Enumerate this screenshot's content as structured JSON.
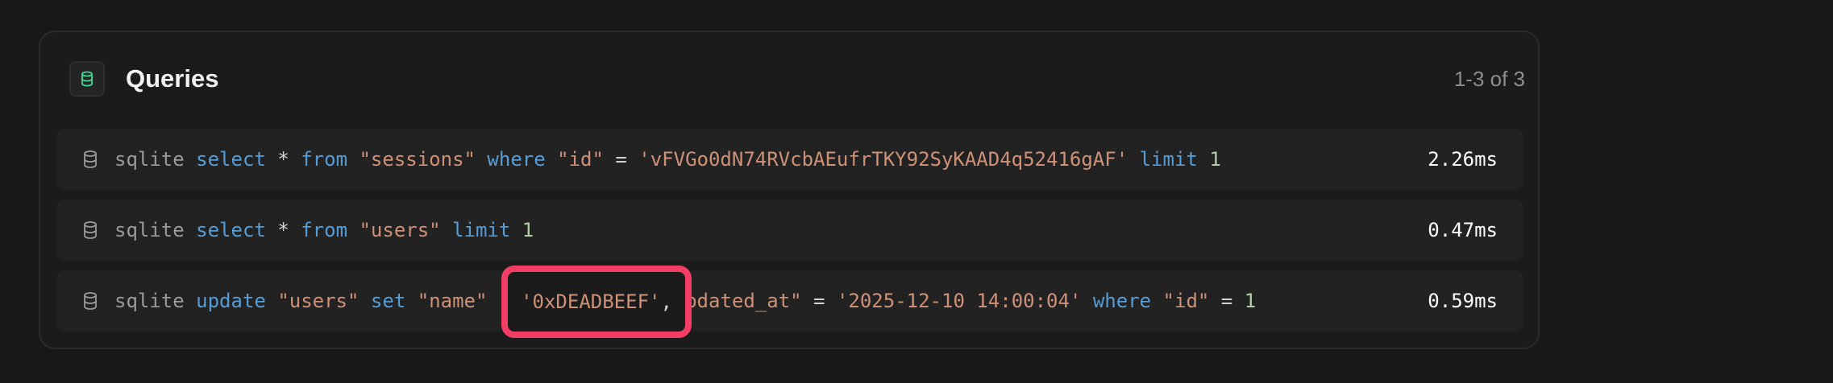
{
  "panel": {
    "title": "Queries",
    "count": "1-3 of 3",
    "icon": "database-icon",
    "icon_color": "#3ddc97"
  },
  "queries": [
    {
      "driver": "sqlite",
      "tokens": [
        {
          "t": "kw",
          "v": "select"
        },
        {
          "t": "op",
          "v": "*"
        },
        {
          "t": "kw",
          "v": "from"
        },
        {
          "t": "str",
          "v": "\"sessions\""
        },
        {
          "t": "kw",
          "v": "where"
        },
        {
          "t": "str",
          "v": "\"id\""
        },
        {
          "t": "op",
          "v": "="
        },
        {
          "t": "str",
          "v": "'vFVGo0dN74RVcbAEufrTKY92SyKAAD4q52416gAF'"
        },
        {
          "t": "kw",
          "v": "limit"
        },
        {
          "t": "num",
          "v": "1"
        }
      ],
      "time": "2.26ms"
    },
    {
      "driver": "sqlite",
      "tokens": [
        {
          "t": "kw",
          "v": "select"
        },
        {
          "t": "op",
          "v": "*"
        },
        {
          "t": "kw",
          "v": "from"
        },
        {
          "t": "str",
          "v": "\"users\""
        },
        {
          "t": "kw",
          "v": "limit"
        },
        {
          "t": "num",
          "v": "1"
        }
      ],
      "time": "0.47ms"
    },
    {
      "driver": "sqlite",
      "tokens": [
        {
          "t": "kw",
          "v": "update"
        },
        {
          "t": "str",
          "v": "\"users\""
        },
        {
          "t": "kw",
          "v": "set"
        },
        {
          "t": "str",
          "v": "\"name\""
        },
        {
          "t": "op",
          "v": " "
        },
        {
          "t": "op",
          "v": "            "
        },
        {
          "t": "str",
          "v": "updated_at\""
        },
        {
          "t": "op",
          "v": "="
        },
        {
          "t": "str",
          "v": "'2025-12-10 14:00:04'"
        },
        {
          "t": "kw",
          "v": "where"
        },
        {
          "t": "str",
          "v": "\"id\""
        },
        {
          "t": "op",
          "v": "="
        },
        {
          "t": "num",
          "v": "1"
        }
      ],
      "time": "0.59ms"
    }
  ],
  "highlight": {
    "value": "'0xDEADBEEF'",
    "suffix": ",",
    "color": "#f23d64"
  },
  "colors": {
    "background": "#181818",
    "keyword": "#569cd6",
    "string": "#ce9178",
    "number": "#b5cea8"
  }
}
